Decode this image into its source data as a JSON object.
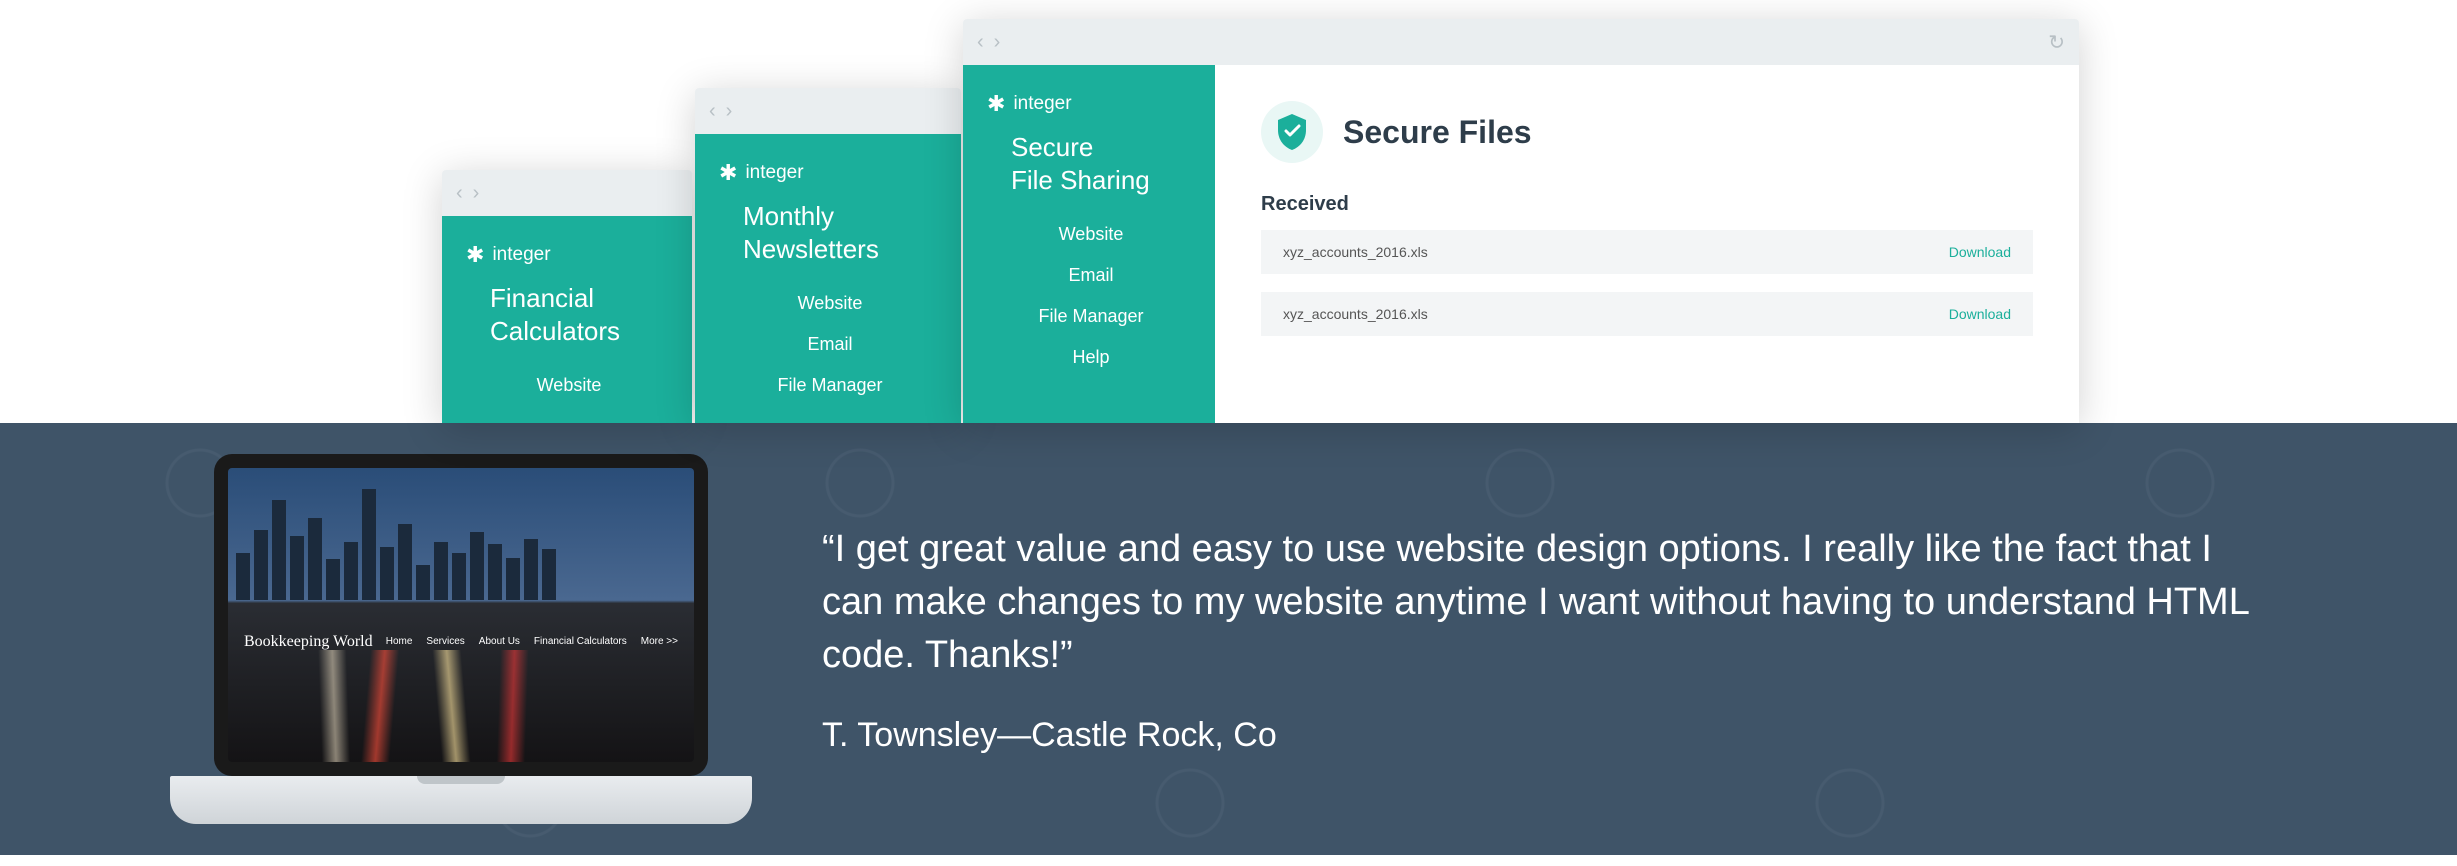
{
  "brand_name": "integer",
  "window1": {
    "title_line1": "Financial",
    "title_line2": "Calculators",
    "items": [
      "Website"
    ]
  },
  "window2": {
    "title_line1": "Monthly",
    "title_line2": "Newsletters",
    "items": [
      "Website",
      "Email",
      "File Manager"
    ]
  },
  "window3": {
    "sidebar_title_line1": "Secure",
    "sidebar_title_line2": "File Sharing",
    "items": [
      "Website",
      "Email",
      "File Manager",
      "Help"
    ],
    "page_title": "Secure Files",
    "section_label": "Received",
    "files": [
      {
        "name": "xyz_accounts_2016.xls",
        "action": "Download"
      },
      {
        "name": "xyz_accounts_2016.xls",
        "action": "Download"
      }
    ]
  },
  "laptop_site": {
    "brand": "Bookkeeping World",
    "nav": [
      "Home",
      "Services",
      "About Us",
      "Financial Calculators",
      "More >>"
    ]
  },
  "testimonial": {
    "quote": "“I get great value and easy to use website design options.  I really like the fact that I can make changes to my website anytime I want without having to understand HTML code.  Thanks!”",
    "attribution": "T. Townsley—Castle Rock, Co"
  }
}
